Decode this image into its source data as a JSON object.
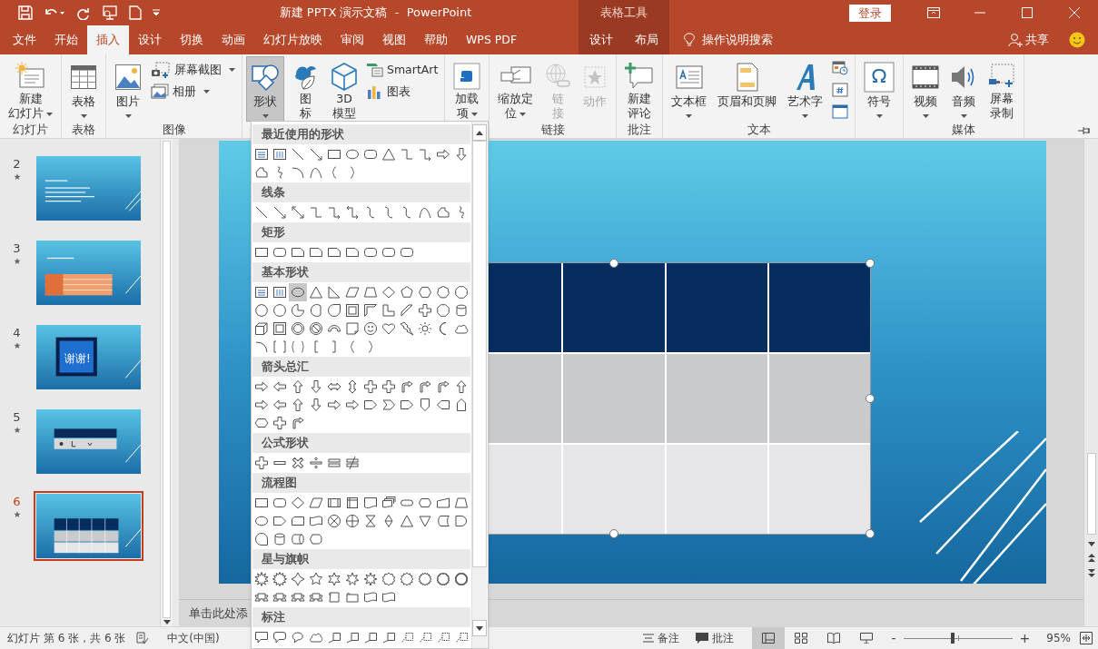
{
  "title_bar": {
    "title": "新建 PPTX 演示文稿  -  PowerPoint",
    "context_label": "表格工具",
    "sign_in": "登录"
  },
  "tabs": [
    {
      "label": "文件",
      "selected": false,
      "contextual": false
    },
    {
      "label": "开始",
      "selected": false,
      "contextual": false
    },
    {
      "label": "插入",
      "selected": true,
      "contextual": false
    },
    {
      "label": "设计",
      "selected": false,
      "contextual": false
    },
    {
      "label": "切换",
      "selected": false,
      "contextual": false
    },
    {
      "label": "动画",
      "selected": false,
      "contextual": false
    },
    {
      "label": "幻灯片放映",
      "selected": false,
      "contextual": false
    },
    {
      "label": "审阅",
      "selected": false,
      "contextual": false
    },
    {
      "label": "视图",
      "selected": false,
      "contextual": false
    },
    {
      "label": "帮助",
      "selected": false,
      "contextual": false
    },
    {
      "label": "WPS PDF",
      "selected": false,
      "contextual": false
    },
    {
      "label": "设计",
      "selected": false,
      "contextual": true
    },
    {
      "label": "布局",
      "selected": false,
      "contextual": true
    }
  ],
  "tell_me": "操作说明搜索",
  "share": "共享",
  "ribbon_groups": [
    {
      "label": "幻灯片",
      "commands": [
        {
          "lines": [
            "新建",
            "幻灯片"
          ],
          "kind": "large",
          "dropdown": true,
          "disabled": false,
          "pressed": false
        }
      ]
    },
    {
      "label": "表格",
      "commands": [
        {
          "label": "表格",
          "kind": "large",
          "dropdown": true,
          "disabled": false,
          "pressed": false
        }
      ]
    },
    {
      "label": "图像",
      "commands": [
        {
          "label": "图片",
          "kind": "large",
          "dropdown": true,
          "disabled": false,
          "pressed": false
        },
        {
          "label": "屏幕截图",
          "kind": "small",
          "dropdown": true,
          "disabled": false,
          "pressed": false
        },
        {
          "label": "相册",
          "kind": "small",
          "dropdown": true,
          "disabled": false,
          "pressed": false
        }
      ]
    },
    {
      "commands": [
        {
          "label": "形状",
          "kind": "large",
          "dropdown": true,
          "disabled": false,
          "pressed": true
        },
        {
          "lines": [
            "图",
            "标"
          ],
          "kind": "large",
          "dropdown": false,
          "disabled": false,
          "pressed": false
        },
        {
          "lines": [
            "3D",
            "模型"
          ],
          "kind": "large",
          "dropdown": false,
          "disabled": false,
          "pressed": false
        },
        {
          "label": "SmartArt",
          "kind": "small",
          "dropdown": false,
          "disabled": false,
          "pressed": false
        },
        {
          "label": "图表",
          "kind": "small",
          "dropdown": false,
          "disabled": false,
          "pressed": false
        }
      ]
    },
    {
      "commands": [
        {
          "lines": [
            "加载",
            "项"
          ],
          "kind": "large",
          "dropdown": true,
          "disabled": false,
          "pressed": false
        }
      ]
    },
    {
      "label": "链接",
      "commands": [
        {
          "lines": [
            "缩放定",
            "位"
          ],
          "kind": "large",
          "dropdown": true,
          "disabled": false,
          "pressed": false
        },
        {
          "lines": [
            "链",
            "接"
          ],
          "kind": "large",
          "dropdown": false,
          "disabled": true,
          "pressed": false
        },
        {
          "label": "动作",
          "kind": "large",
          "dropdown": false,
          "disabled": true,
          "pressed": false
        }
      ]
    },
    {
      "label": "批注",
      "commands": [
        {
          "lines": [
            "新建",
            "评论"
          ],
          "kind": "large",
          "dropdown": false,
          "disabled": false,
          "pressed": false
        }
      ]
    },
    {
      "label": "文本",
      "commands": [
        {
          "label": "文本框",
          "kind": "large",
          "dropdown": true,
          "disabled": false,
          "pressed": false
        },
        {
          "label": "页眉和页脚",
          "kind": "large",
          "dropdown": false,
          "disabled": false,
          "pressed": false
        },
        {
          "label": "艺术字",
          "kind": "large",
          "dropdown": true,
          "disabled": false,
          "pressed": false
        },
        {
          "kind": "icon",
          "disabled": false,
          "pressed": false
        },
        {
          "kind": "icon",
          "disabled": false,
          "pressed": false
        },
        {
          "kind": "icon",
          "disabled": false,
          "pressed": false
        }
      ]
    },
    {
      "commands": [
        {
          "label": "符号",
          "kind": "large",
          "dropdown": true,
          "disabled": false,
          "pressed": false
        }
      ]
    },
    {
      "label": "媒体",
      "commands": [
        {
          "label": "视频",
          "kind": "large",
          "dropdown": true,
          "disabled": false,
          "pressed": false
        },
        {
          "label": "音频",
          "kind": "large",
          "dropdown": true,
          "disabled": false,
          "pressed": false
        },
        {
          "lines": [
            "屏幕",
            "录制"
          ],
          "kind": "large",
          "dropdown": false,
          "disabled": false,
          "pressed": false
        }
      ]
    }
  ],
  "shapes_menu": {
    "sections": [
      {
        "title": "最近使用的形状",
        "shapes": [
          {
            "kind": "textbox",
            "selected": false
          },
          {
            "kind": "vtextbox",
            "selected": false
          },
          {
            "kind": "line",
            "selected": false
          },
          {
            "kind": "arrowline",
            "selected": false
          },
          {
            "kind": "rect",
            "selected": false
          },
          {
            "kind": "oval",
            "selected": false
          },
          {
            "kind": "roundrect",
            "selected": false
          },
          {
            "kind": "triangle",
            "selected": false
          },
          {
            "kind": "elbow",
            "selected": false
          },
          {
            "kind": "elbowarrow",
            "selected": false
          },
          {
            "kind": "arrow-r",
            "selected": false
          },
          {
            "kind": "arrow-d",
            "selected": false
          },
          {
            "kind": "freeform",
            "selected": false
          },
          {
            "kind": "scribble",
            "selected": false
          },
          {
            "kind": "arc",
            "selected": false
          },
          {
            "kind": "curve",
            "selected": false
          },
          {
            "kind": "brace-l",
            "selected": false
          },
          {
            "kind": "brace-r",
            "selected": false
          }
        ]
      },
      {
        "title": "线条",
        "shapes": [
          {
            "kind": "line",
            "selected": false
          },
          {
            "kind": "arrowline",
            "selected": false
          },
          {
            "kind": "dblarrow",
            "selected": false
          },
          {
            "kind": "elbow",
            "selected": false
          },
          {
            "kind": "elbowarrow",
            "selected": false
          },
          {
            "kind": "elbowdbl",
            "selected": false
          },
          {
            "kind": "curveconn",
            "selected": false
          },
          {
            "kind": "curvearrow",
            "selected": false
          },
          {
            "kind": "curvedbl",
            "selected": false
          },
          {
            "kind": "curve",
            "selected": false
          },
          {
            "kind": "freeform",
            "selected": false
          },
          {
            "kind": "scribble",
            "selected": false
          }
        ]
      },
      {
        "title": "矩形",
        "shapes": [
          {
            "kind": "rect",
            "selected": false
          },
          {
            "kind": "roundrect",
            "selected": false
          },
          {
            "kind": "snip",
            "selected": false
          },
          {
            "kind": "snip-top",
            "selected": false
          },
          {
            "kind": "snip-diag",
            "selected": false
          },
          {
            "kind": "round-snip",
            "selected": false
          },
          {
            "kind": "round-one",
            "selected": false
          },
          {
            "kind": "round-top",
            "selected": false
          },
          {
            "kind": "round-diag",
            "selected": false
          }
        ]
      },
      {
        "title": "基本形状",
        "shapes": [
          {
            "kind": "textbox",
            "selected": false
          },
          {
            "kind": "vtextbox",
            "selected": false
          },
          {
            "kind": "oval",
            "selected": true
          },
          {
            "kind": "triangle",
            "selected": false
          },
          {
            "kind": "rtriangle",
            "selected": false
          },
          {
            "kind": "parallelogram",
            "selected": false
          },
          {
            "kind": "trapezoid",
            "selected": false
          },
          {
            "kind": "diamond",
            "selected": false
          },
          {
            "kind": "pentagon",
            "selected": false
          },
          {
            "kind": "hexagon",
            "selected": false
          },
          {
            "kind": "heptagon",
            "selected": false
          },
          {
            "kind": "octagon",
            "selected": false
          },
          {
            "kind": "decagon",
            "selected": false
          },
          {
            "kind": "dodecagon",
            "selected": false
          },
          {
            "kind": "pie",
            "selected": false
          },
          {
            "kind": "chord",
            "selected": false
          },
          {
            "kind": "teardrop",
            "selected": false
          },
          {
            "kind": "frame",
            "selected": false
          },
          {
            "kind": "halfframe",
            "selected": false
          },
          {
            "kind": "lshape",
            "selected": false
          },
          {
            "kind": "diagstripe",
            "selected": false
          },
          {
            "kind": "plus",
            "selected": false
          },
          {
            "kind": "plaque",
            "selected": false
          },
          {
            "kind": "cylinder",
            "selected": false
          },
          {
            "kind": "cube",
            "selected": false
          },
          {
            "kind": "bevel",
            "selected": false
          },
          {
            "kind": "donut",
            "selected": false
          },
          {
            "kind": "nosymbol",
            "selected": false
          },
          {
            "kind": "blockarc",
            "selected": false
          },
          {
            "kind": "foldedcorner",
            "selected": false
          },
          {
            "kind": "smiley",
            "selected": false
          },
          {
            "kind": "heart",
            "selected": false
          },
          {
            "kind": "lightning",
            "selected": false
          },
          {
            "kind": "sun",
            "selected": false
          },
          {
            "kind": "moon",
            "selected": false
          },
          {
            "kind": "cloud",
            "selected": false
          },
          {
            "kind": "arc",
            "selected": false
          },
          {
            "kind": "bracket-pair",
            "selected": false
          },
          {
            "kind": "brace-pair",
            "selected": false
          },
          {
            "kind": "bracket-l",
            "selected": false
          },
          {
            "kind": "bracket-r",
            "selected": false
          },
          {
            "kind": "brace-l",
            "selected": false
          },
          {
            "kind": "brace-r",
            "selected": false
          }
        ]
      },
      {
        "title": "箭头总汇",
        "shapes": [
          {
            "kind": "arrow-r",
            "selected": false
          },
          {
            "kind": "arrow-l",
            "selected": false
          },
          {
            "kind": "arrow-u",
            "selected": false
          },
          {
            "kind": "arrow-d",
            "selected": false
          },
          {
            "kind": "arrow-lr",
            "selected": false
          },
          {
            "kind": "arrow-ud",
            "selected": false
          },
          {
            "kind": "arrow-quad",
            "selected": false
          },
          {
            "kind": "arrow-lru",
            "selected": false
          },
          {
            "kind": "bent-arrow",
            "selected": false
          },
          {
            "kind": "uturn",
            "selected": false
          },
          {
            "kind": "arrow-lu",
            "selected": false
          },
          {
            "kind": "bent-up",
            "selected": false
          },
          {
            "kind": "curved-r",
            "selected": false
          },
          {
            "kind": "curved-l",
            "selected": false
          },
          {
            "kind": "curved-u",
            "selected": false
          },
          {
            "kind": "curved-d",
            "selected": false
          },
          {
            "kind": "striped-r",
            "selected": false
          },
          {
            "kind": "notched-r",
            "selected": false
          },
          {
            "kind": "pentagon-arrow",
            "selected": false
          },
          {
            "kind": "chevron",
            "selected": false
          },
          {
            "kind": "callout-arrow-r",
            "selected": false
          },
          {
            "kind": "callout-arrow-d",
            "selected": false
          },
          {
            "kind": "callout-arrow-l",
            "selected": false
          },
          {
            "kind": "callout-arrow-u",
            "selected": false
          },
          {
            "kind": "callout-arrow-lr",
            "selected": false
          },
          {
            "kind": "callout-arrow-quad",
            "selected": false
          },
          {
            "kind": "circular",
            "selected": false
          }
        ]
      },
      {
        "title": "公式形状",
        "shapes": [
          {
            "kind": "plus",
            "selected": false
          },
          {
            "kind": "minus",
            "selected": false
          },
          {
            "kind": "multiply",
            "selected": false
          },
          {
            "kind": "divide",
            "selected": false
          },
          {
            "kind": "equal",
            "selected": false
          },
          {
            "kind": "notequal",
            "selected": false
          }
        ]
      },
      {
        "title": "流程图",
        "shapes": [
          {
            "kind": "rect",
            "selected": false
          },
          {
            "kind": "roundrect",
            "selected": false
          },
          {
            "kind": "diamond",
            "selected": false
          },
          {
            "kind": "parallelogram",
            "selected": false
          },
          {
            "kind": "predefined",
            "selected": false
          },
          {
            "kind": "internal-storage",
            "selected": false
          },
          {
            "kind": "document",
            "selected": false
          },
          {
            "kind": "multidoc",
            "selected": false
          },
          {
            "kind": "terminator",
            "selected": false
          },
          {
            "kind": "preparation",
            "selected": false
          },
          {
            "kind": "manual-input",
            "selected": false
          },
          {
            "kind": "manual-op",
            "selected": false
          },
          {
            "kind": "connector",
            "selected": false
          },
          {
            "kind": "offpage",
            "selected": false
          },
          {
            "kind": "card",
            "selected": false
          },
          {
            "kind": "punched-tape",
            "selected": false
          },
          {
            "kind": "summing",
            "selected": false
          },
          {
            "kind": "or",
            "selected": false
          },
          {
            "kind": "collate",
            "selected": false
          },
          {
            "kind": "sort",
            "selected": false
          },
          {
            "kind": "triangle",
            "selected": false
          },
          {
            "kind": "merge",
            "selected": false
          },
          {
            "kind": "stored-data",
            "selected": false
          },
          {
            "kind": "delay",
            "selected": false
          },
          {
            "kind": "seq-storage",
            "selected": false
          },
          {
            "kind": "disk",
            "selected": false
          },
          {
            "kind": "direct-storage",
            "selected": false
          },
          {
            "kind": "display",
            "selected": false
          }
        ]
      },
      {
        "title": "星与旗帜",
        "shapes": [
          {
            "kind": "burst1",
            "selected": false
          },
          {
            "kind": "burst2",
            "selected": false
          },
          {
            "kind": "star4",
            "selected": false
          },
          {
            "kind": "star5",
            "selected": false
          },
          {
            "kind": "star6",
            "selected": false
          },
          {
            "kind": "star7",
            "selected": false
          },
          {
            "kind": "star8",
            "selected": false
          },
          {
            "kind": "star10",
            "selected": false
          },
          {
            "kind": "star12",
            "selected": false
          },
          {
            "kind": "star16",
            "selected": false
          },
          {
            "kind": "star24",
            "selected": false
          },
          {
            "kind": "star32",
            "selected": false
          },
          {
            "kind": "ribbon",
            "selected": false
          },
          {
            "kind": "ribbon",
            "selected": false
          },
          {
            "kind": "ribbon",
            "selected": false
          },
          {
            "kind": "ribbon",
            "selected": false
          },
          {
            "kind": "vscroll",
            "selected": false
          },
          {
            "kind": "hscroll",
            "selected": false
          },
          {
            "kind": "wave-flag",
            "selected": false
          },
          {
            "kind": "wave-flag",
            "selected": false
          }
        ]
      },
      {
        "title": "标注",
        "shapes": [
          {
            "kind": "callout-rect",
            "selected": false
          },
          {
            "kind": "callout-round",
            "selected": false
          },
          {
            "kind": "callout-oval",
            "selected": false
          },
          {
            "kind": "callout-cloud",
            "selected": false
          },
          {
            "kind": "line-callout",
            "selected": false
          },
          {
            "kind": "line-callout",
            "selected": false
          },
          {
            "kind": "line-callout",
            "selected": false
          },
          {
            "kind": "line-callout",
            "selected": false
          },
          {
            "kind": "dash-callout",
            "selected": false
          },
          {
            "kind": "dash-callout",
            "selected": false
          },
          {
            "kind": "dash-callout",
            "selected": false
          },
          {
            "kind": "dash-callout",
            "selected": false
          }
        ]
      }
    ]
  },
  "slides": [
    {
      "number": "2",
      "selected": false,
      "kind": "text"
    },
    {
      "number": "3",
      "selected": false,
      "kind": "orange-table"
    },
    {
      "number": "4",
      "selected": false,
      "kind": "closing",
      "title": "谢谢!"
    },
    {
      "number": "5",
      "selected": false,
      "kind": "icon-table"
    },
    {
      "number": "6",
      "selected": true,
      "kind": "blue-table"
    }
  ],
  "slide_table": {
    "selected": true,
    "rows": [
      {
        "kind": "header"
      },
      {
        "kind": "band"
      },
      {
        "kind": "light"
      }
    ]
  },
  "notes_placeholder": "单击此处添",
  "status_bar": {
    "slide_info": "幻灯片 第 6 张，共 6 张",
    "language": "中文(中国)",
    "notes": "备注",
    "comments": "批注",
    "views": [
      {
        "selected": true
      },
      {
        "selected": false
      },
      {
        "selected": false
      },
      {
        "selected": false
      }
    ],
    "zoom": {
      "level": 0.45,
      "reading": "95%",
      "minus": "-",
      "plus": "+"
    }
  }
}
